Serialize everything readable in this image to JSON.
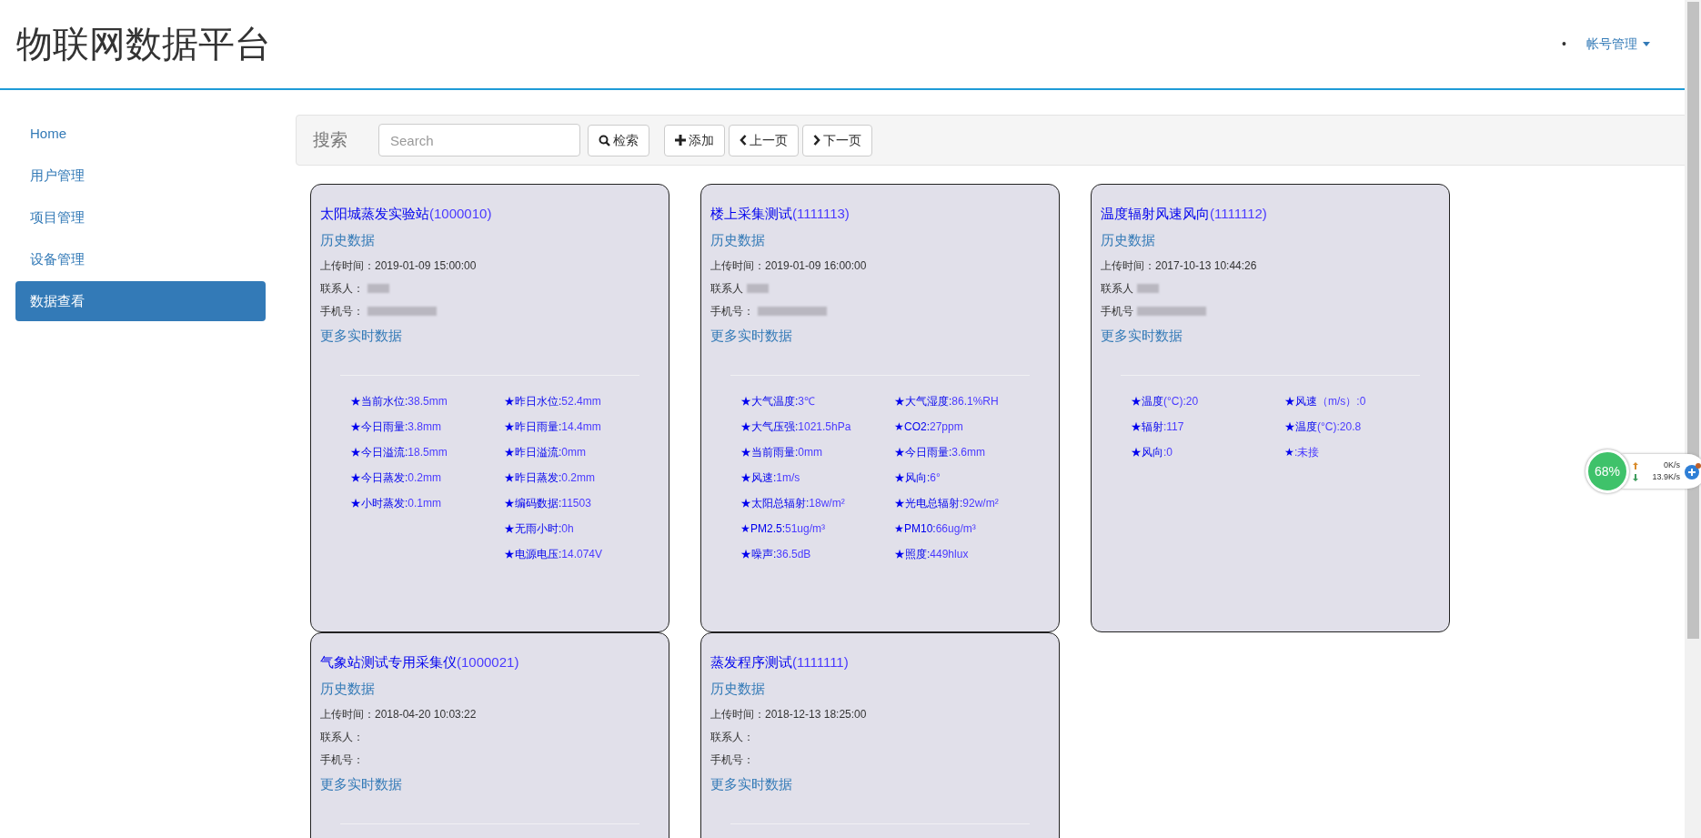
{
  "header": {
    "title": "物联网数据平台",
    "bullet": "•",
    "account_menu": "帐号管理"
  },
  "sidebar": {
    "items": [
      {
        "label": "Home",
        "selected": false
      },
      {
        "label": "用户管理",
        "selected": false
      },
      {
        "label": "项目管理",
        "selected": false
      },
      {
        "label": "设备管理",
        "selected": false
      },
      {
        "label": "数据查看",
        "selected": true
      }
    ]
  },
  "toolbar": {
    "label": "搜索",
    "search": {
      "placeholder": "Search"
    },
    "buttons": [
      {
        "kind": "search",
        "label": "检索"
      },
      {
        "kind": "add",
        "label": "添加"
      },
      {
        "kind": "prev",
        "label": "上一页"
      },
      {
        "kind": "next",
        "label": "下一页"
      }
    ]
  },
  "cards": [
    {
      "title": "太阳城蒸发实验站",
      "id": "(1000010)",
      "history_link": "历史数据",
      "upload_label": "上传时间：",
      "upload_time": "2019-01-09 15:00:00",
      "contact_label": "联系人：",
      "contact_blurred": true,
      "phone_label": "手机号：",
      "phone_blurred": true,
      "more_link": "更多实时数据",
      "readings_left": [
        {
          "label": "★当前水位:",
          "value": "38.5mm"
        },
        {
          "label": "★今日雨量:",
          "value": "3.8mm"
        },
        {
          "label": "★今日溢流:",
          "value": "18.5mm"
        },
        {
          "label": "★今日蒸发:",
          "value": "0.2mm"
        },
        {
          "label": "★小时蒸发:",
          "value": "0.1mm"
        }
      ],
      "readings_right": [
        {
          "label": "★昨日水位:",
          "value": "52.4mm"
        },
        {
          "label": "★昨日雨量:",
          "value": "14.4mm"
        },
        {
          "label": "★昨日溢流:",
          "value": "0mm"
        },
        {
          "label": "★昨日蒸发:",
          "value": "0.2mm"
        },
        {
          "label": "★编码数据:",
          "value": "11503"
        },
        {
          "label": "★无雨小时:",
          "value": "0h"
        },
        {
          "label": "★电源电压:",
          "value": "14.074V"
        }
      ]
    },
    {
      "title": "楼上采集测试",
      "id": "(1111113)",
      "history_link": "历史数据",
      "upload_label": "上传时间：",
      "upload_time": "2019-01-09 16:00:00",
      "contact_label": "联系人",
      "contact_blurred": true,
      "phone_label": "手机号：",
      "phone_blurred": true,
      "more_link": "更多实时数据",
      "readings_left": [
        {
          "label": "★大气温度:",
          "value": "3℃"
        },
        {
          "label": "★大气压强:",
          "value": "1021.5hPa"
        },
        {
          "label": "★当前雨量:",
          "value": "0mm"
        },
        {
          "label": "★风速:",
          "value": "1m/s"
        },
        {
          "label": "★太阳总辐射:",
          "value": "18w/m²"
        },
        {
          "label": "★PM2.5:",
          "value": "51ug/m³"
        },
        {
          "label": "★噪声:",
          "value": "36.5dB"
        }
      ],
      "readings_right": [
        {
          "label": "★大气湿度:",
          "value": "86.1%RH"
        },
        {
          "label": "★CO2:",
          "value": "27ppm"
        },
        {
          "label": "★今日雨量:",
          "value": "3.6mm"
        },
        {
          "label": "★风向:",
          "value": "6°"
        },
        {
          "label": "★光电总辐射:",
          "value": "92w/m²"
        },
        {
          "label": "★PM10:",
          "value": "66ug/m³"
        },
        {
          "label": "★照度:",
          "value": "449hlux"
        }
      ]
    },
    {
      "title": "温度辐射风速风向",
      "id": "(1111112)",
      "history_link": "历史数据",
      "upload_label": "上传时间：",
      "upload_time": "2017-10-13 10:44:26",
      "contact_label": "联系人",
      "contact_blurred": true,
      "phone_label": "手机号",
      "phone_blurred": true,
      "more_link": "更多实时数据",
      "readings_left": [
        {
          "label": "★温度",
          "value": "(°C):20"
        },
        {
          "label": "★辐射",
          "value": ":117"
        },
        {
          "label": "★风向",
          "value": ":0"
        }
      ],
      "readings_right": [
        {
          "label": "★风速",
          "value": "（m/s）:0"
        },
        {
          "label": "★温度",
          "value": "(°C):20.8"
        },
        {
          "label": "★",
          "value": ":未接"
        }
      ]
    },
    {
      "title": "气象站测试专用采集仪",
      "id": "(1000021)",
      "history_link": "历史数据",
      "upload_label": "上传时间：",
      "upload_time": "2018-04-20 10:03:22",
      "contact_label": "联系人：",
      "contact_blurred": false,
      "phone_label": "手机号：",
      "phone_blurred": false,
      "more_link": "更多实时数据"
    },
    {
      "title": "蒸发程序测试",
      "id": "(1111111)",
      "history_link": "历史数据",
      "upload_label": "上传时间：",
      "upload_time": "2018-12-13 18:25:00",
      "contact_label": "联系人：",
      "contact_blurred": false,
      "phone_label": "手机号：",
      "phone_blurred": false,
      "more_link": "更多实时数据"
    }
  ],
  "network_widget": {
    "percent": "68%",
    "upload": "0K/s",
    "download": "13.9K/s"
  }
}
